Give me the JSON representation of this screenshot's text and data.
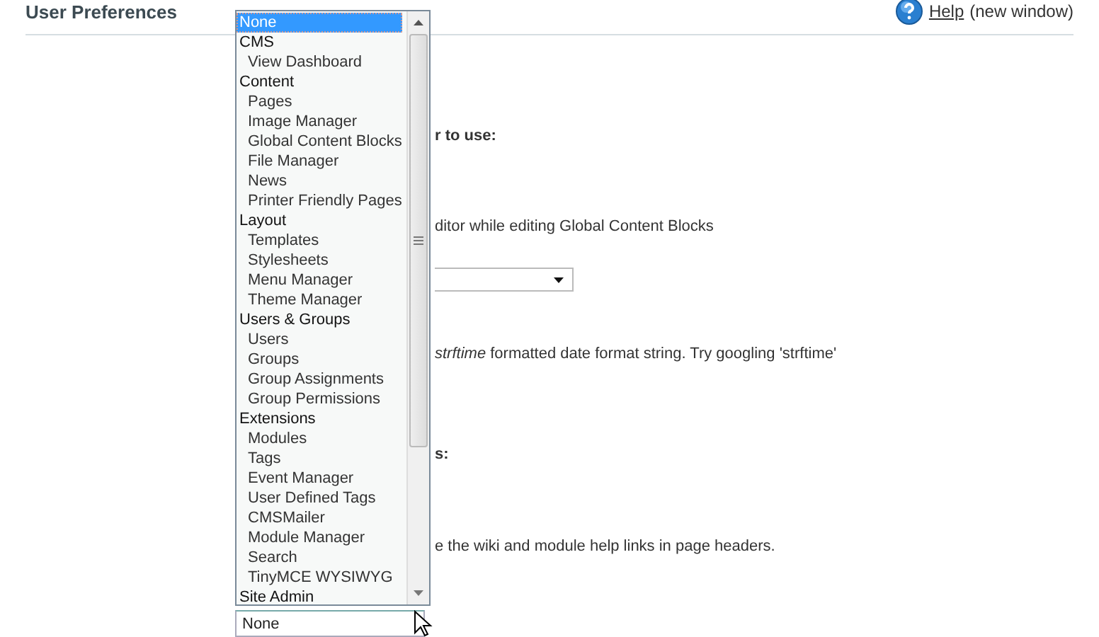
{
  "page": {
    "title": "User Preferences",
    "help_link": "Help",
    "help_note": "(new window)"
  },
  "background": {
    "heading_1": "r to use:",
    "text_1": "ditor while editing Global Content Blocks",
    "text_2": "*strftime* formatted date format string. Try googling 'strftime'",
    "heading_2": "s:",
    "text_3": "e the wiki and module help links in page headers."
  },
  "dropdown": {
    "value": "None",
    "options": [
      {
        "label": "None",
        "selected": true
      },
      {
        "label": "CMS",
        "selected": false,
        "children": [
          {
            "label": "View Dashboard",
            "selected": false
          }
        ]
      },
      {
        "label": "Content",
        "selected": false,
        "children": [
          {
            "label": "Pages",
            "selected": false
          },
          {
            "label": "Image Manager",
            "selected": false
          },
          {
            "label": "Global Content Blocks",
            "selected": false
          },
          {
            "label": "File Manager",
            "selected": false
          },
          {
            "label": "News",
            "selected": false
          },
          {
            "label": "Printer Friendly Pages",
            "selected": false
          }
        ]
      },
      {
        "label": "Layout",
        "selected": false,
        "children": [
          {
            "label": "Templates",
            "selected": false
          },
          {
            "label": "Stylesheets",
            "selected": false
          },
          {
            "label": "Menu Manager",
            "selected": false
          },
          {
            "label": "Theme Manager",
            "selected": false
          }
        ]
      },
      {
        "label": "Users & Groups",
        "selected": false,
        "children": [
          {
            "label": "Users",
            "selected": false
          },
          {
            "label": "Groups",
            "selected": false
          },
          {
            "label": "Group Assignments",
            "selected": false
          },
          {
            "label": "Group Permissions",
            "selected": false
          }
        ]
      },
      {
        "label": "Extensions",
        "selected": false,
        "children": [
          {
            "label": "Modules",
            "selected": false
          },
          {
            "label": "Tags",
            "selected": false
          },
          {
            "label": "Event Manager",
            "selected": false
          },
          {
            "label": "User Defined Tags",
            "selected": false
          },
          {
            "label": "CMSMailer",
            "selected": false
          },
          {
            "label": "Module Manager",
            "selected": false
          },
          {
            "label": "Search",
            "selected": false
          },
          {
            "label": "TinyMCE WYSIWYG",
            "selected": false
          }
        ]
      },
      {
        "label": "Site Admin",
        "selected": false
      }
    ]
  }
}
